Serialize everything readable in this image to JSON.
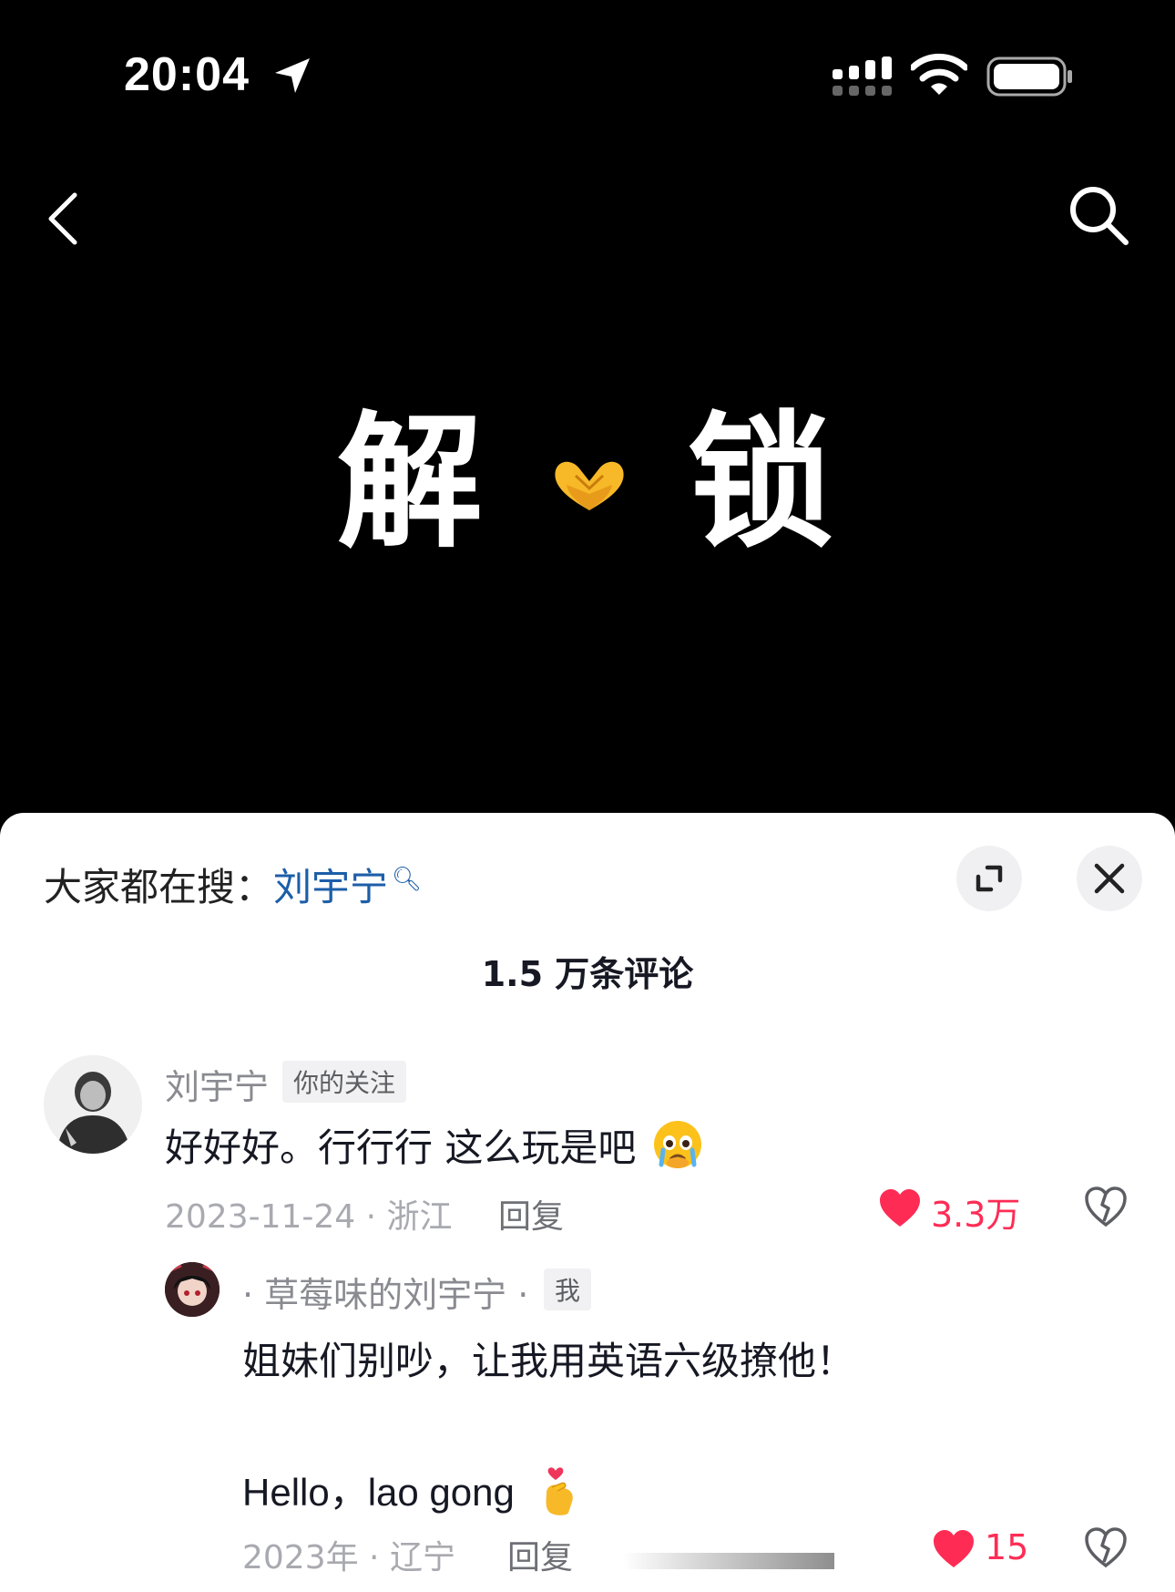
{
  "status_bar": {
    "time": "20:04"
  },
  "video": {
    "title_left": "解",
    "title_right": "锁",
    "emoji": "heart-hands"
  },
  "sheet": {
    "search_prefix": "大家都在搜：",
    "search_term": "刘宇宁",
    "comment_count": "1.5 万条评论"
  },
  "comments": [
    {
      "username": "刘宇宁",
      "badge": "你的关注",
      "text": "好好好。行行行 这么玩是吧",
      "date_location": "2023-11-24 · 浙江",
      "reply_label": "回复",
      "likes": "3.3万"
    },
    {
      "username": "· 草莓味的刘宇宁 ·",
      "badge": "我",
      "text_line1": "姐妹们别吵，让我用英语六级撩他！",
      "text_line2": "Hello，lao gong",
      "date_location": "2023年 · 辽宁",
      "reply_label": "回复",
      "likes": "15"
    }
  ],
  "colors": {
    "accent_like": "#fe2c55",
    "link_blue": "#1d5ea8"
  }
}
